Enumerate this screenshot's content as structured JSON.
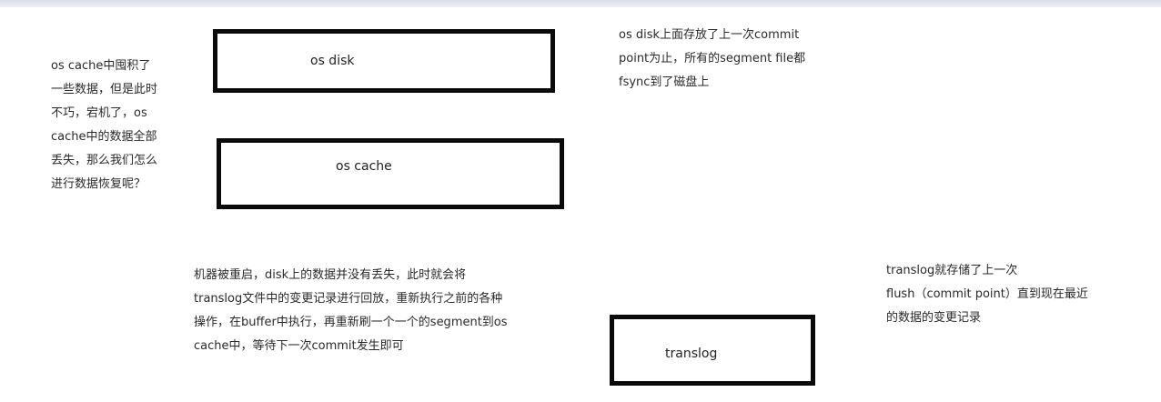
{
  "boxes": {
    "os_disk": "os disk",
    "os_cache": "os cache",
    "translog": "translog"
  },
  "notes": {
    "cache_loss_question": "os cache中囤积了\n一些数据，但是此时\n不巧，宕机了，os\ncache中的数据全部\n丢失，那么我们怎么\n进行数据恢复呢？",
    "disk_commit_point": "os disk上面存放了上一次commit\npoint为止，所有的segment file都\nfsync到了磁盘上",
    "restart_recovery": "机器被重启，disk上的数据并没有丢失，此时就会将\ntranslog文件中的变更记录进行回放，重新执行之前的各种\n操作，在buffer中执行，再重新刷一个一个的segment到os\ncache中，等待下一次commit发生即可",
    "translog_records": "translog就存储了上一次\nflush（commit point）直到现在最近\n的数据的变更记录"
  }
}
